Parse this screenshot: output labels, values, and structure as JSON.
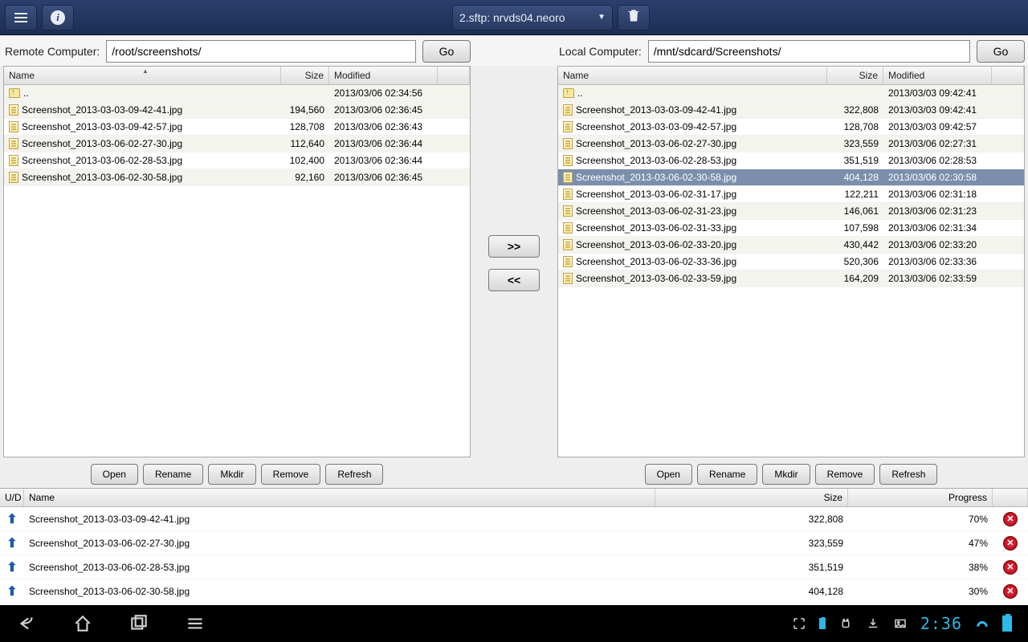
{
  "topbar": {
    "connection": "2.sftp: nrvds04.neoro"
  },
  "remote": {
    "label": "Remote Computer:",
    "path": "/root/screenshots/",
    "go": "Go",
    "cols": {
      "name": "Name",
      "size": "Size",
      "mod": "Modified"
    },
    "updir": "..",
    "updir_mod": "2013/03/06 02:34:56",
    "rows": [
      {
        "name": "Screenshot_2013-03-03-09-42-41.jpg",
        "size": "194,560",
        "mod": "2013/03/06 02:36:45"
      },
      {
        "name": "Screenshot_2013-03-03-09-42-57.jpg",
        "size": "128,708",
        "mod": "2013/03/06 02:36:43"
      },
      {
        "name": "Screenshot_2013-03-06-02-27-30.jpg",
        "size": "112,640",
        "mod": "2013/03/06 02:36:44"
      },
      {
        "name": "Screenshot_2013-03-06-02-28-53.jpg",
        "size": "102,400",
        "mod": "2013/03/06 02:36:44"
      },
      {
        "name": "Screenshot_2013-03-06-02-30-58.jpg",
        "size": "92,160",
        "mod": "2013/03/06 02:36:45"
      }
    ]
  },
  "local": {
    "label": "Local Computer:",
    "path": "/mnt/sdcard/Screenshots/",
    "go": "Go",
    "cols": {
      "name": "Name",
      "size": "Size",
      "mod": "Modified"
    },
    "updir": "..",
    "updir_mod": "2013/03/03 09:42:41",
    "rows": [
      {
        "name": "Screenshot_2013-03-03-09-42-41.jpg",
        "size": "322,808",
        "mod": "2013/03/03 09:42:41"
      },
      {
        "name": "Screenshot_2013-03-03-09-42-57.jpg",
        "size": "128,708",
        "mod": "2013/03/03 09:42:57"
      },
      {
        "name": "Screenshot_2013-03-06-02-27-30.jpg",
        "size": "323,559",
        "mod": "2013/03/06 02:27:31"
      },
      {
        "name": "Screenshot_2013-03-06-02-28-53.jpg",
        "size": "351,519",
        "mod": "2013/03/06 02:28:53"
      },
      {
        "name": "Screenshot_2013-03-06-02-30-58.jpg",
        "size": "404,128",
        "mod": "2013/03/06 02:30:58",
        "selected": true
      },
      {
        "name": "Screenshot_2013-03-06-02-31-17.jpg",
        "size": "122,211",
        "mod": "2013/03/06 02:31:18"
      },
      {
        "name": "Screenshot_2013-03-06-02-31-23.jpg",
        "size": "146,061",
        "mod": "2013/03/06 02:31:23"
      },
      {
        "name": "Screenshot_2013-03-06-02-31-33.jpg",
        "size": "107,598",
        "mod": "2013/03/06 02:31:34"
      },
      {
        "name": "Screenshot_2013-03-06-02-33-20.jpg",
        "size": "430,442",
        "mod": "2013/03/06 02:33:20"
      },
      {
        "name": "Screenshot_2013-03-06-02-33-36.jpg",
        "size": "520,306",
        "mod": "2013/03/06 02:33:36"
      },
      {
        "name": "Screenshot_2013-03-06-02-33-59.jpg",
        "size": "164,209",
        "mod": "2013/03/06 02:33:59"
      }
    ]
  },
  "xfer": {
    "to_local": ">>",
    "to_remote": "<<"
  },
  "actions": {
    "open": "Open",
    "rename": "Rename",
    "mkdir": "Mkdir",
    "remove": "Remove",
    "refresh": "Refresh"
  },
  "queue": {
    "cols": {
      "ud": "U/D",
      "name": "Name",
      "size": "Size",
      "prog": "Progress"
    },
    "rows": [
      {
        "name": "Screenshot_2013-03-03-09-42-41.jpg",
        "size": "322,808",
        "prog": "70%"
      },
      {
        "name": "Screenshot_2013-03-06-02-27-30.jpg",
        "size": "323,559",
        "prog": "47%"
      },
      {
        "name": "Screenshot_2013-03-06-02-28-53.jpg",
        "size": "351,519",
        "prog": "38%"
      },
      {
        "name": "Screenshot_2013-03-06-02-30-58.jpg",
        "size": "404,128",
        "prog": "30%"
      }
    ]
  },
  "navbar": {
    "clock": "2:36"
  }
}
